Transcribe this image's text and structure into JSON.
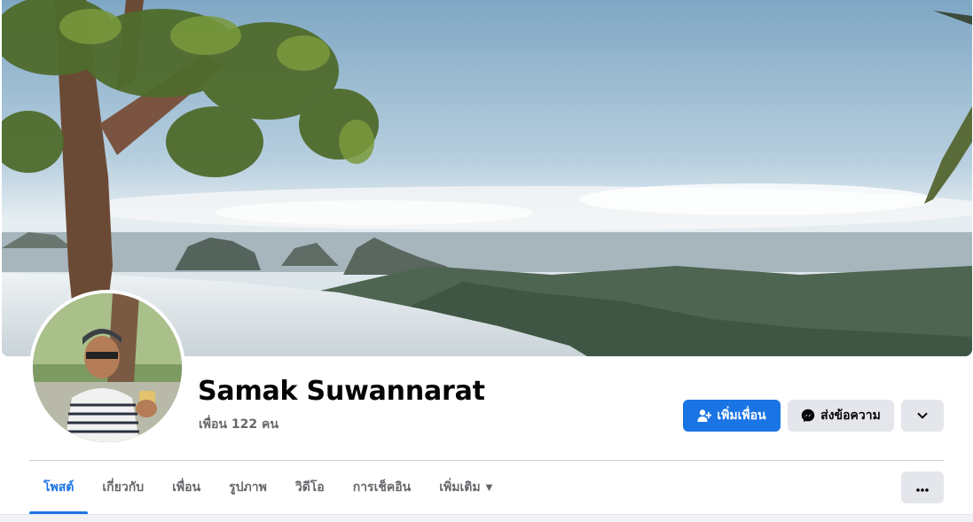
{
  "profile": {
    "name": "Samak Suwannarat",
    "friends": "เพื่อน 122 คน"
  },
  "actions": {
    "add_friend": "เพิ่มเพื่อน",
    "message": "ส่งข้อความ",
    "more_icon": "chevron-down-icon"
  },
  "tabs": [
    {
      "label": "โพสต์",
      "active": true
    },
    {
      "label": "เกี่ยวกับ",
      "active": false
    },
    {
      "label": "เพื่อน",
      "active": false
    },
    {
      "label": "รูปภาพ",
      "active": false
    },
    {
      "label": "วิดีโอ",
      "active": false
    },
    {
      "label": "การเช็คอิน",
      "active": false
    },
    {
      "label": "เพิ่มเติม",
      "active": false,
      "dropdown": true
    }
  ],
  "colors": {
    "accent": "#1b74e4",
    "secondary_button": "#e4e6eb",
    "muted_text": "#65676b"
  }
}
